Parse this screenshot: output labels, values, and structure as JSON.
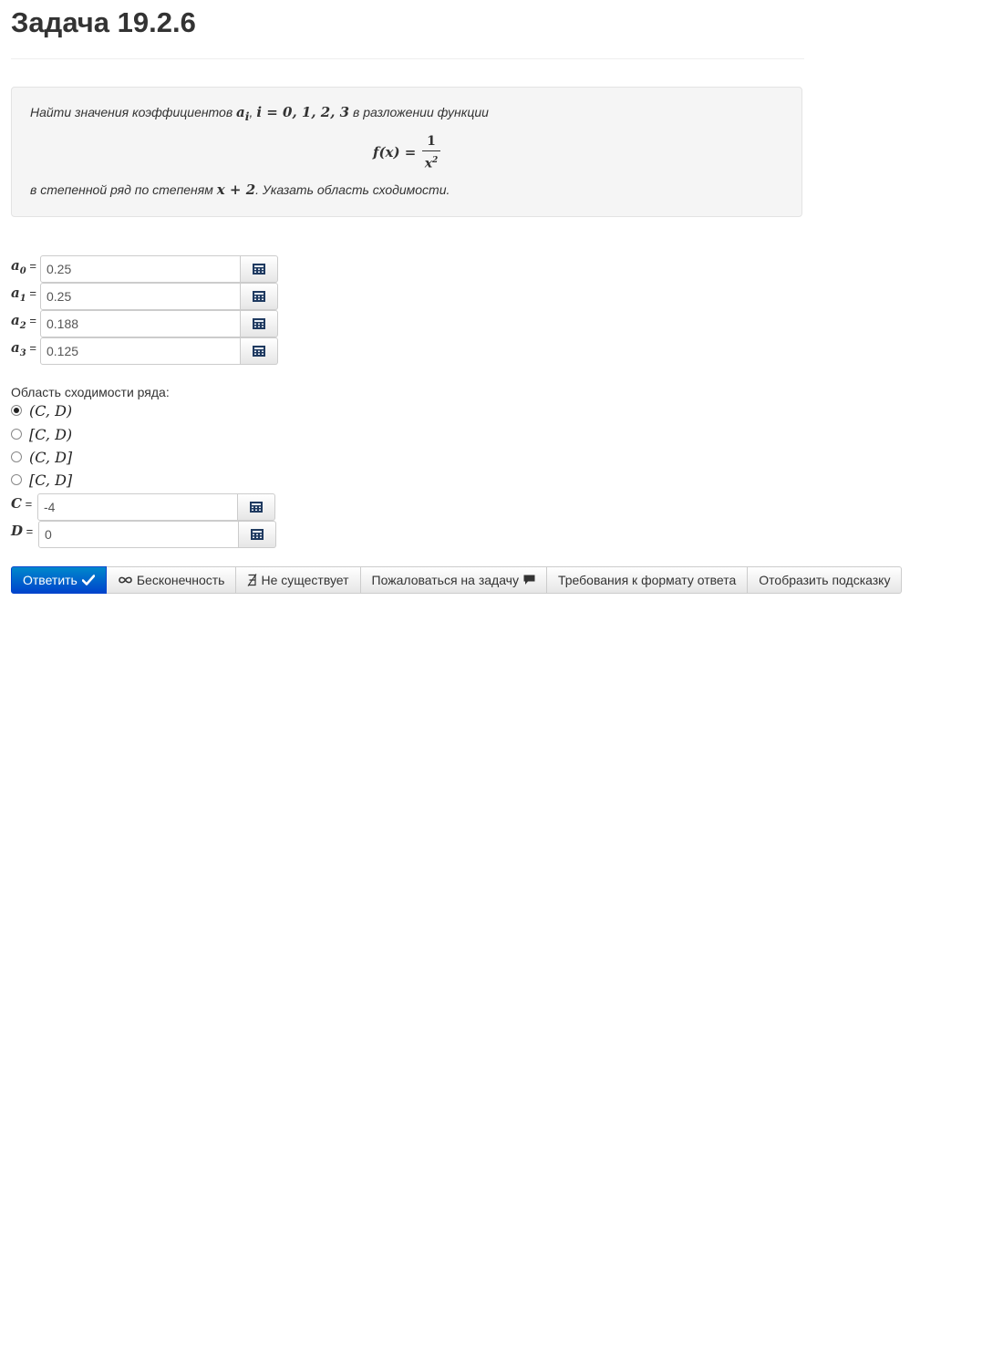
{
  "title": "Задача 19.2.6",
  "problem": {
    "text_before": "Найти значения коэффициентов",
    "math_ai": "a",
    "math_ai_sub": "i",
    "math_i_list": "i = 0, 1, 2, 3",
    "text_middle": "в разложении функции",
    "formula_lhs": "f(x) =",
    "formula_num": "1",
    "formula_den": "x",
    "formula_den_exp": "2",
    "text_after_1": "в степенной ряд по степеням",
    "math_x2": "x + 2",
    "text_after_2": ". Указать область сходимости."
  },
  "coefficients": [
    {
      "name": "a",
      "sub": "0",
      "eq": " =",
      "value": "0.25"
    },
    {
      "name": "a",
      "sub": "1",
      "eq": " =",
      "value": "0.25"
    },
    {
      "name": "a",
      "sub": "2",
      "eq": " =",
      "value": "0.188"
    },
    {
      "name": "a",
      "sub": "3",
      "eq": " =",
      "value": "0.125"
    }
  ],
  "convergence": {
    "label": "Область сходимости ряда:",
    "options": [
      {
        "text": "(C, D)",
        "checked": true
      },
      {
        "text": "[C, D)",
        "checked": false
      },
      {
        "text": "(C, D]",
        "checked": false
      },
      {
        "text": "[C, D]",
        "checked": false
      }
    ],
    "C": {
      "name": "C",
      "eq": " =",
      "value": "-4"
    },
    "D": {
      "name": "D",
      "eq": " =",
      "value": "0"
    }
  },
  "buttons": {
    "answer": "Ответить",
    "infinity": "Бесконечность",
    "not_exists": "Не существует",
    "report": "Пожаловаться на задачу",
    "format": "Требования к формату ответа",
    "hint": "Отобразить подсказку"
  },
  "colors": {
    "primary": "#0055cc",
    "well_bg": "#f5f5f5"
  }
}
